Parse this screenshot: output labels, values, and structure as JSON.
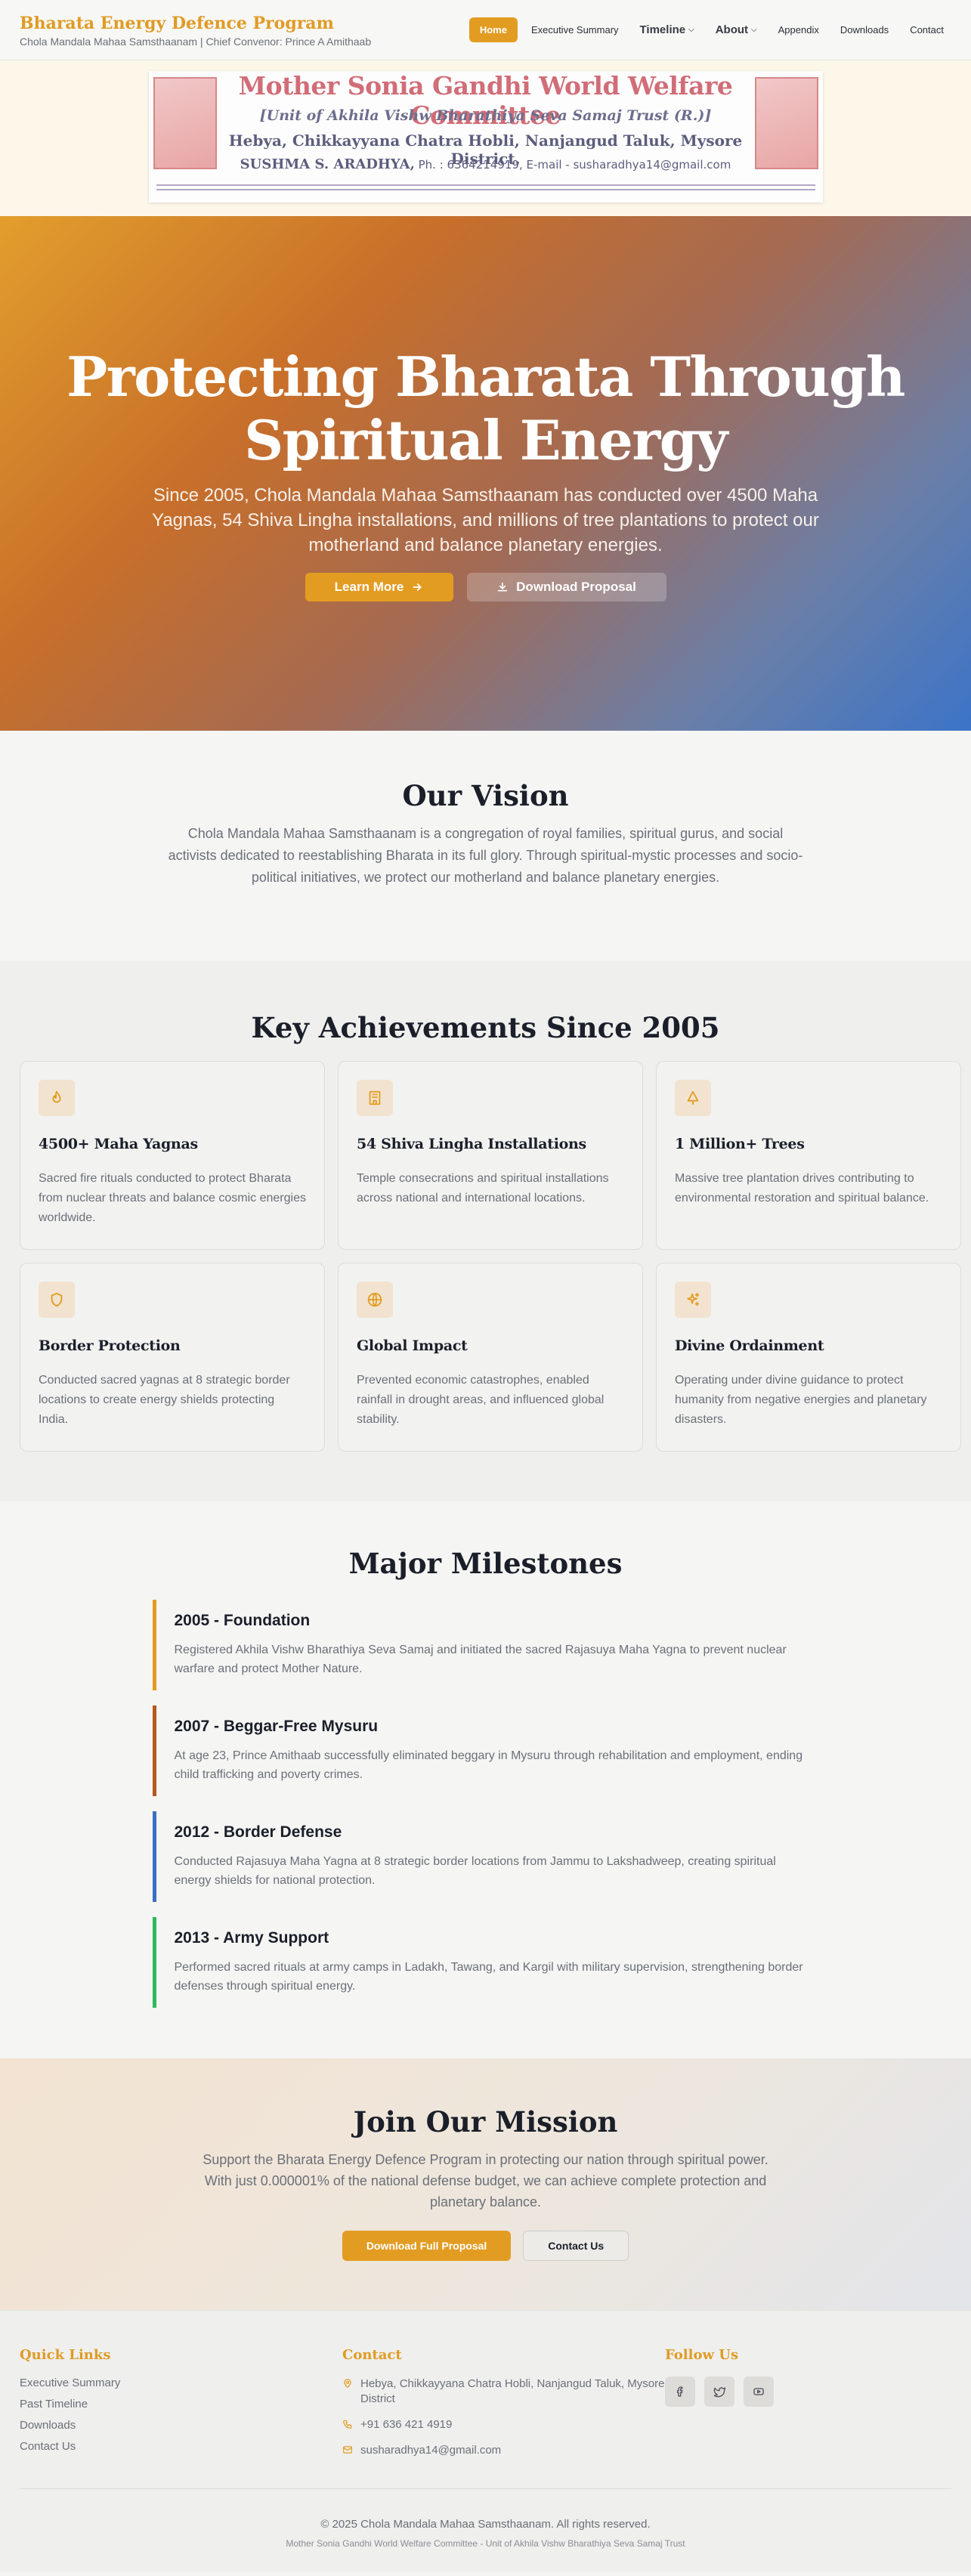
{
  "header": {
    "title": "Bharata Energy Defence Program",
    "subtitle": "Chola Mandala Mahaa Samsthaanam | Chief Convenor: Prince A Amithaab",
    "nav": [
      {
        "label": "Home",
        "active": true
      },
      {
        "label": "Executive Summary"
      },
      {
        "label": "Timeline",
        "dropdown": true
      },
      {
        "label": "About",
        "dropdown": true
      },
      {
        "label": "Appendix"
      },
      {
        "label": "Downloads"
      },
      {
        "label": "Contact"
      }
    ]
  },
  "banner": {
    "title": "Mother Sonia Gandhi World Welfare Committee",
    "unit": "[Unit of Akhila Vishw Bharathiya Seva Samaj Trust (R.)]",
    "address": "Hebya, Chikkayyana Chatra Hobli, Nanjangud Taluk, Mysore District.",
    "name": "SUSHMA S. ARADHYA,",
    "contact": "Ph. : 6364214919, E-mail - susharadhya14@gmail.com"
  },
  "hero": {
    "title": "Protecting Bharata Through Spiritual Energy",
    "text": "Since 2005, Chola Mandala Mahaa Samsthaanam has conducted over 4500 Maha Yagnas, 54 Shiva Lingha installations, and millions of tree plantations to protect our motherland and balance planetary energies.",
    "learn_more": "Learn More",
    "download": "Download Proposal"
  },
  "vision": {
    "title": "Our Vision",
    "text": "Chola Mandala Mahaa Samsthaanam is a congregation of royal families, spiritual gurus, and social activists dedicated to reestablishing Bharata in its full glory. Through spiritual-mystic processes and socio-political initiatives, we protect our motherland and balance planetary energies."
  },
  "achievements": {
    "title": "Key Achievements Since 2005",
    "items": [
      {
        "icon": "flame-icon",
        "title": "4500+ Maha Yagnas",
        "text": "Sacred fire rituals conducted to protect Bharata from nuclear threats and balance cosmic energies worldwide."
      },
      {
        "icon": "temple-icon",
        "title": "54 Shiva Lingha Installations",
        "text": "Temple consecrations and spiritual installations across national and international locations."
      },
      {
        "icon": "tree-icon",
        "title": "1 Million+ Trees",
        "text": "Massive tree plantation drives contributing to environmental restoration and spiritual balance."
      },
      {
        "icon": "shield-icon",
        "title": "Border Protection",
        "text": "Conducted sacred yagnas at 8 strategic border locations to create energy shields protecting India."
      },
      {
        "icon": "globe-icon",
        "title": "Global Impact",
        "text": "Prevented economic catastrophes, enabled rainfall in drought areas, and influenced global stability."
      },
      {
        "icon": "sparkles-icon",
        "title": "Divine Ordainment",
        "text": "Operating under divine guidance to protect humanity from negative energies and planetary disasters."
      }
    ]
  },
  "milestones": {
    "title": "Major Milestones",
    "items": [
      {
        "title": "2005 - Foundation",
        "text": "Registered Akhila Vishw Bharathiya Seva Samaj and initiated the sacred Rajasuya Maha Yagna to prevent nuclear warfare and protect Mother Nature.",
        "color": "#e39c22"
      },
      {
        "title": "2007 - Beggar-Free Mysuru",
        "text": "At age 23, Prince Amithaab successfully eliminated beggary in Mysuru through rehabilitation and employment, ending child trafficking and poverty crimes.",
        "color": "#b5591f"
      },
      {
        "title": "2012 - Border Defense",
        "text": "Conducted Rajasuya Maha Yagna at 8 strategic border locations from Jammu to Lakshadweep, creating spiritual energy shields for national protection.",
        "color": "#3d6fc4"
      },
      {
        "title": "2013 - Army Support",
        "text": "Performed sacred rituals at army camps in Ladakh, Tawang, and Kargil with military supervision, strengthening border defenses through spiritual energy.",
        "color": "#2fb85c"
      }
    ]
  },
  "join": {
    "title": "Join Our Mission",
    "text": "Support the Bharata Energy Defence Program in protecting our nation through spiritual power. With just 0.000001% of the national defense budget, we can achieve complete protection and planetary balance.",
    "download": "Download Full Proposal",
    "contact": "Contact Us"
  },
  "footer": {
    "quick_links_title": "Quick Links",
    "links": [
      "Executive Summary",
      "Past Timeline",
      "Downloads",
      "Contact Us"
    ],
    "contact_title": "Contact",
    "address": "Hebya, Chikkayyana Chatra Hobli, Nanjangud Taluk, Mysore District",
    "phone": "+91 636 421 4919",
    "email": "susharadhya14@gmail.com",
    "follow_title": "Follow Us",
    "socials": [
      "facebook-icon",
      "twitter-icon",
      "youtube-icon"
    ],
    "copyright": "© 2025 Chola Mandala Mahaa Samsthaanam. All rights reserved.",
    "subline": "Mother Sonia Gandhi World Welfare Committee - Unit of Akhila Vishw Bharathiya Seva Samaj Trust"
  },
  "colors": {
    "accent": "#e39c22",
    "heading": "#1b1f2a",
    "muted": "#6b6f78"
  }
}
